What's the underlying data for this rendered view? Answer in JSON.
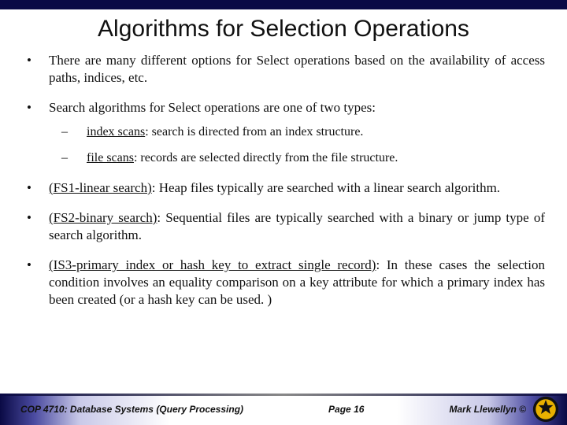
{
  "title": "Algorithms for Selection Operations",
  "bullets": [
    {
      "text": "There are many different options for Select operations based on the availability of access paths, indices, etc."
    },
    {
      "text": "Search algorithms for Select operations are one of two types:",
      "sub": [
        {
          "u": "index scans",
          "rest": ": search is directed from an index structure."
        },
        {
          "u": "file scans",
          "rest": ": records are selected directly from the file structure."
        }
      ]
    },
    {
      "u": "(FS1-linear search)",
      "rest": ": Heap files typically are searched with a linear search algorithm."
    },
    {
      "u": "(FS2-binary search)",
      "rest": ": Sequential files are typically searched with a binary or jump type of search algorithm."
    },
    {
      "u": "(IS3-primary index or hash key to extract single record)",
      "rest": ": In these cases the selection condition involves an equality comparison on a key attribute for which a primary index has been created (or a hash key can be used. )"
    }
  ],
  "footer": {
    "course": "COP 4710: Database Systems (Query Processing)",
    "page": "Page 16",
    "author": "Mark Llewellyn ©"
  }
}
